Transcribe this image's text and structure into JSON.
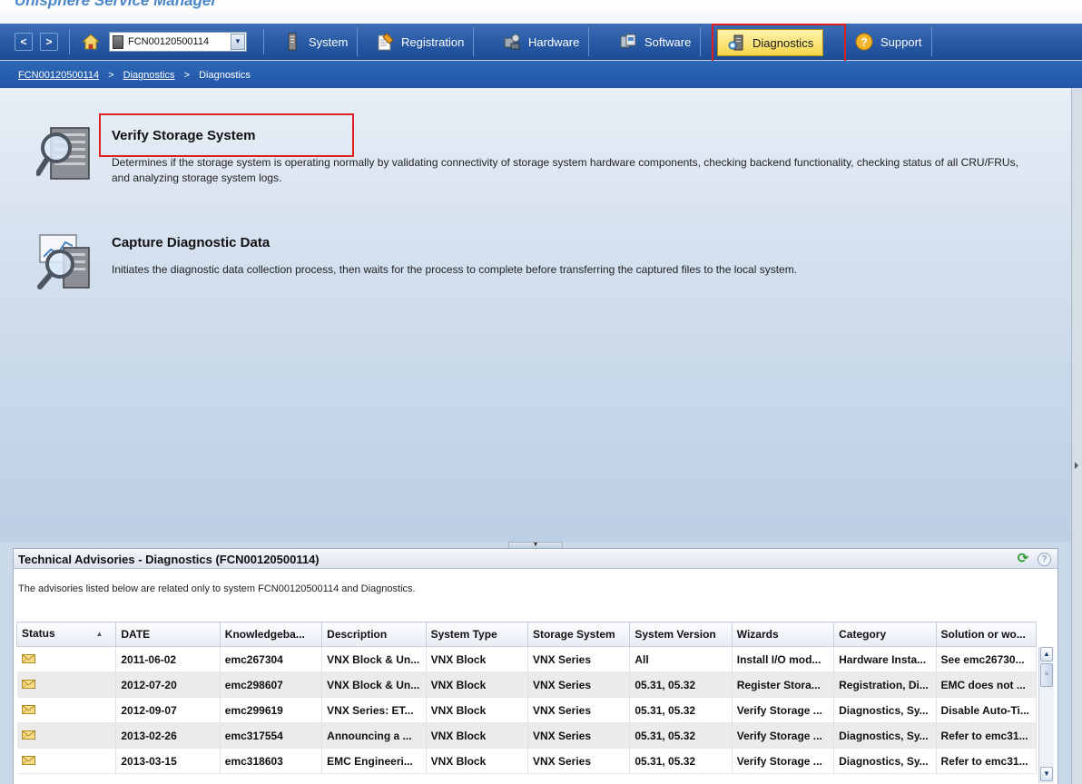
{
  "app": {
    "title": "Unisphere Service Manager"
  },
  "nav": {
    "back_label": "<",
    "forward_label": ">",
    "system_select": {
      "value": "FCN00120500114"
    },
    "tabs": [
      {
        "label": "System",
        "icon": "server-icon"
      },
      {
        "label": "Registration",
        "icon": "clipboard-icon"
      },
      {
        "label": "Hardware",
        "icon": "hardware-icon"
      },
      {
        "label": "Software",
        "icon": "software-icon"
      },
      {
        "label": "Diagnostics",
        "icon": "diagnostics-icon",
        "active": true
      },
      {
        "label": "Support",
        "icon": "support-icon"
      }
    ]
  },
  "breadcrumb": {
    "items": [
      "FCN00120500114",
      "Diagnostics",
      "Diagnostics"
    ],
    "separator": ">"
  },
  "actions": [
    {
      "title": "Verify Storage System",
      "description": "Determines if the storage system is operating normally by validating connectivity of storage system hardware components, checking backend functionality, checking status of all CRU/FRUs, and analyzing storage system logs.",
      "icon": "magnifier-server-icon"
    },
    {
      "title": "Capture Diagnostic Data",
      "description": "Initiates the diagnostic data collection process, then waits for the process to complete before transferring the captured files to the local system.",
      "icon": "magnifier-chart-icon"
    }
  ],
  "advisories": {
    "title": "Technical Advisories - Diagnostics (FCN00120500114)",
    "note": "The advisories listed below are related only to system FCN00120500114 and Diagnostics.",
    "columns": [
      "Status",
      "DATE",
      "Knowledgeba...",
      "Description",
      "System Type",
      "Storage System",
      "System Version",
      "Wizards",
      "Category",
      "Solution or wo..."
    ],
    "rows": [
      [
        "",
        "2011-06-02",
        "emc267304",
        "VNX Block & Un...",
        "VNX Block",
        "VNX Series",
        "All",
        "Install I/O mod...",
        "Hardware Insta...",
        "See emc26730..."
      ],
      [
        "",
        "2012-07-20",
        "emc298607",
        "VNX Block & Un...",
        "VNX Block",
        "VNX Series",
        "05.31, 05.32",
        "Register Stora...",
        "Registration, Di...",
        "EMC does not ..."
      ],
      [
        "",
        "2012-09-07",
        "emc299619",
        "VNX Series: ET...",
        "VNX Block",
        "VNX Series",
        "05.31, 05.32",
        "Verify Storage ...",
        "Diagnostics, Sy...",
        "Disable Auto-Ti..."
      ],
      [
        "",
        "2013-02-26",
        "emc317554",
        "Announcing a ...",
        "VNX Block",
        "VNX Series",
        "05.31, 05.32",
        "Verify Storage ...",
        "Diagnostics, Sy...",
        "Refer to emc31..."
      ],
      [
        "",
        "2013-03-15",
        "emc318603",
        "EMC Engineeri...",
        "VNX Block",
        "VNX Series",
        "05.31, 05.32",
        "Verify Storage ...",
        "Diagnostics, Sy...",
        "Refer to emc31..."
      ]
    ]
  },
  "colors": {
    "navbar": "#2a5ba6",
    "active_tab": "#f7d64a",
    "highlight": "#e02020",
    "alt_row": "#ebebeb"
  }
}
